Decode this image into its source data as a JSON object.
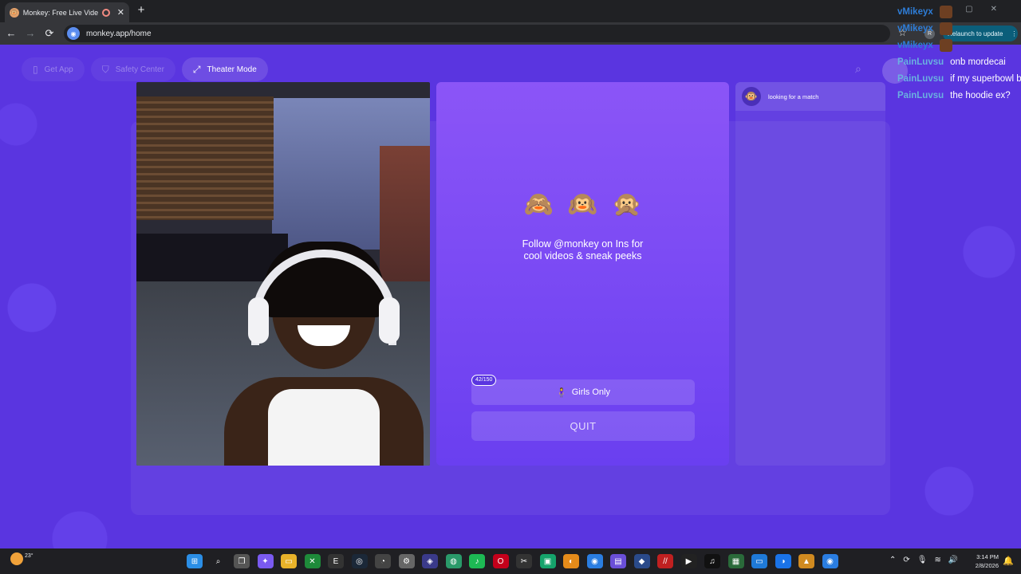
{
  "browser": {
    "tab_title": "Monkey: Free Live Video Ch",
    "tab_close": "✕",
    "new_tab": "+",
    "url": "monkey.app/home",
    "back": "←",
    "forward": "→",
    "reload": "⟳",
    "star": "☆",
    "profile_initial": "R",
    "relaunch_label": "Relaunch to update",
    "menu": "⋮",
    "win_minimize": "—",
    "win_maximize": "▢",
    "win_close": "✕"
  },
  "nav": {
    "get_app": "Get App",
    "safety_center": "Safety Center",
    "theater_mode": "Theater Mode"
  },
  "center": {
    "emojis": [
      "🙈",
      "🙉",
      "🙊"
    ],
    "follow_line1": "Follow @monkey on Ins for",
    "follow_line2": "cool videos & sneak peeks",
    "counter": "42/150",
    "girls_emoji": "🧍‍♀️",
    "girls_only": "Girls Only",
    "quit": "QUIT"
  },
  "chat": {
    "avatar_emoji": "🐵",
    "status": "looking for a match"
  },
  "stream_chat": [
    {
      "user": "vMikeyx",
      "text": ""
    },
    {
      "user": "vMikeyx",
      "text": ""
    },
    {
      "user": "vMikeyx",
      "text": ""
    },
    {
      "user": "PainLuvsu",
      "text": "onb mordecai"
    },
    {
      "user": "PainLuvsu",
      "text": "if my superbowl b"
    },
    {
      "user": "PainLuvsu",
      "text": "the hoodie ex?"
    }
  ],
  "taskbar": {
    "temperature": "23°",
    "time": "3:14 PM",
    "date": "2/8/2026"
  },
  "colors": {
    "page_bg": "#5a35e0",
    "panel_top": "#8b55f7",
    "panel_bottom": "#6a3ff0",
    "chat_user": "#2e7dd7"
  }
}
